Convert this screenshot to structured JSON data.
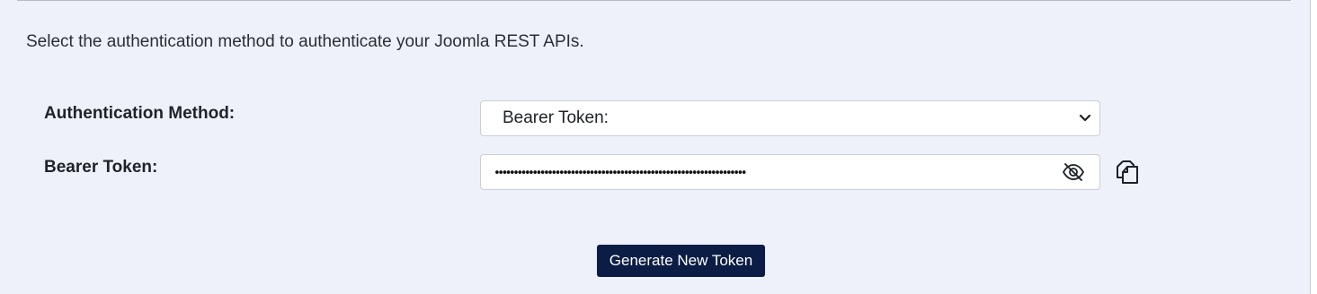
{
  "intro_text": "Select the authentication method to authenticate your Joomla REST APIs.",
  "auth_method": {
    "label": "Authentication Method:",
    "selected": "Bearer Token:"
  },
  "bearer_token": {
    "label": "Bearer Token:",
    "masked_value": "••••••••••••••••••••••••••••••••••••••••••••••••••••••••••••••••••",
    "toggle_icon": "eye-off-icon",
    "copy_icon": "copy-icon"
  },
  "actions": {
    "generate_label": "Generate New Token"
  },
  "colors": {
    "page_background": "#eef1fa",
    "button_background": "#0b1d45",
    "button_text": "#ffffff",
    "field_border": "#c9ced6"
  }
}
